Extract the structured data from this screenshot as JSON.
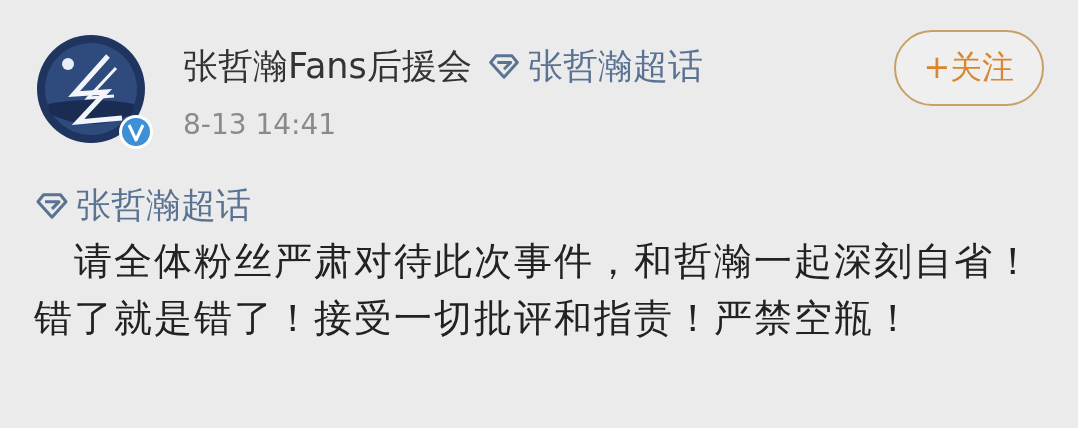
{
  "post": {
    "author": "张哲瀚Fans后援会",
    "verified": true,
    "author_topic": "张哲瀚超话",
    "time": "8-13 14:41",
    "follow_button": "+关注",
    "topic": "张哲瀚超话",
    "text": "请全体粉丝严肃对待此次事件，和哲瀚一起深刻自省！错了就是错了！接受一切批评和指责！严禁空瓶！"
  }
}
